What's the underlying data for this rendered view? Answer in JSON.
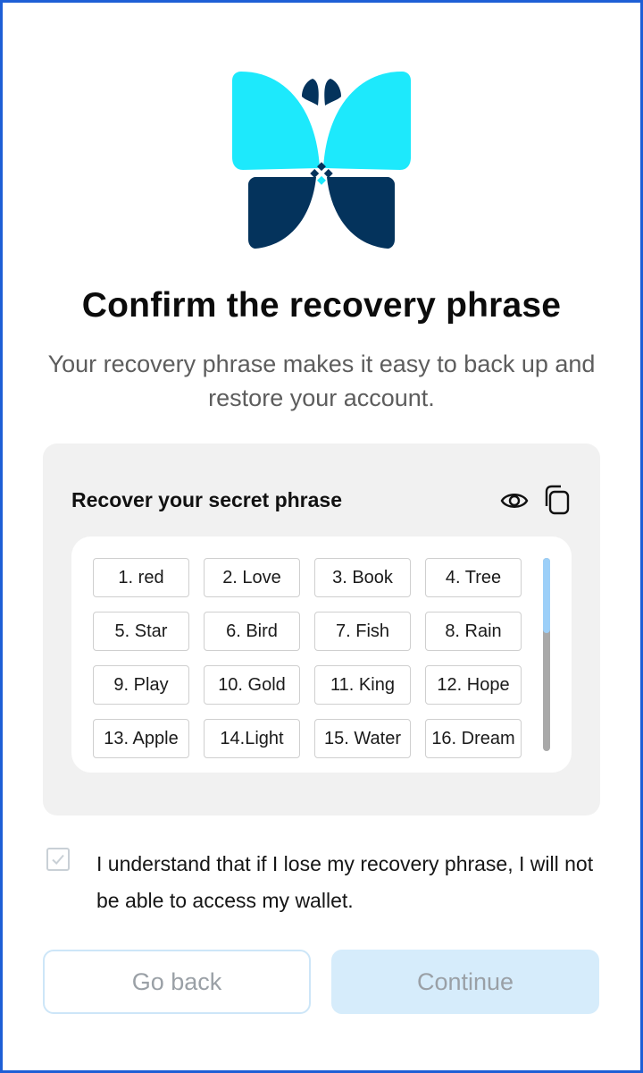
{
  "header": {
    "title": "Confirm the recovery phrase",
    "subtitle": "Your recovery phrase makes it easy to back up and restore your account."
  },
  "phrase_card": {
    "title": "Recover your secret phrase",
    "words": [
      "1. red",
      "2. Love",
      "3. Book",
      "4. Tree",
      "5. Star",
      "6. Bird",
      "7. Fish",
      "8. Rain",
      "9. Play",
      "10. Gold",
      "11. King",
      "12. Hope",
      "13. Apple",
      "14.Light",
      "15. Water",
      "16. Dream"
    ]
  },
  "agreement": {
    "checked": true,
    "text": "I understand that if I lose my recovery phrase, I will not be able to access my wallet."
  },
  "buttons": {
    "back_label": "Go back",
    "continue_label": "Continue"
  },
  "colors": {
    "logo_light": "#1de9fc",
    "logo_dark": "#04335c",
    "frame_border": "#1e5fd6",
    "scroll_thumb": "#9ccff8",
    "continue_bg": "#d6ecfb"
  },
  "icons": [
    "butterfly-logo",
    "eye-icon",
    "copy-icon",
    "check-icon"
  ]
}
